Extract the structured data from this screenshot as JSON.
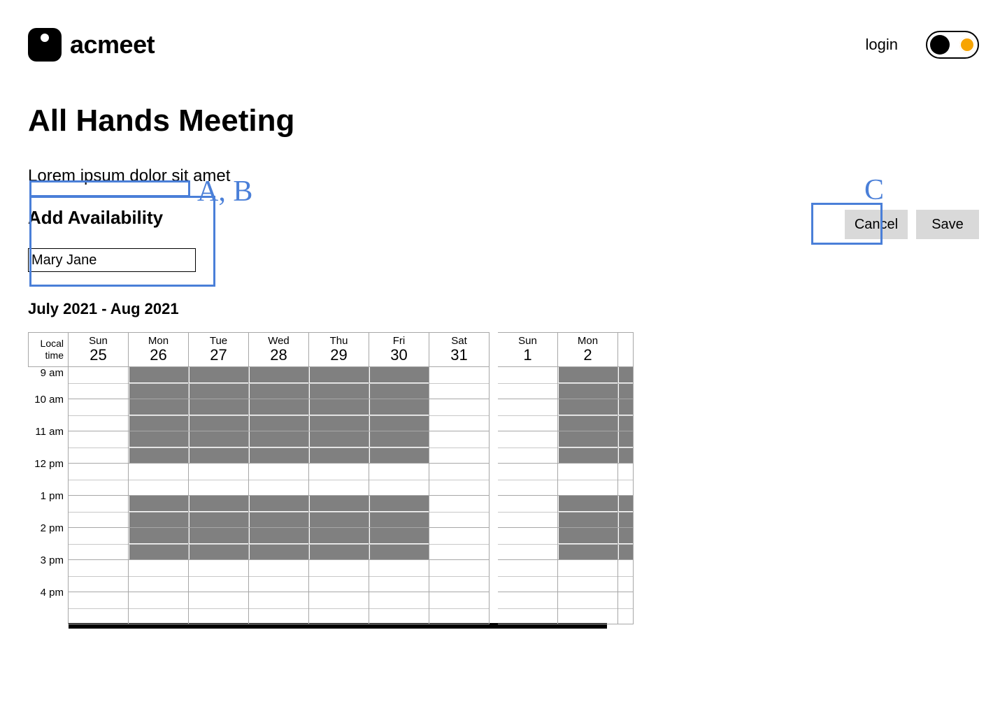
{
  "header": {
    "brand": "acmeet",
    "login": "login"
  },
  "page": {
    "title": "All Hands Meeting",
    "subtitle": "Lorem ipsum dolor sit amet",
    "section_label": "Add Availability",
    "name_value": "Mary Jane",
    "date_range": "July 2021 - Aug  2021"
  },
  "actions": {
    "cancel": "Cancel",
    "save": "Save"
  },
  "schedule": {
    "tz_label_line1": "Local",
    "tz_label_line2": "time",
    "times": [
      "9 am",
      "10 am",
      "11 am",
      "12 pm",
      "1 pm",
      "2 pm",
      "3 pm",
      "4 pm"
    ],
    "days": [
      {
        "dow": "Sun",
        "num": "25"
      },
      {
        "dow": "Mon",
        "num": "26"
      },
      {
        "dow": "Tue",
        "num": "27"
      },
      {
        "dow": "Wed",
        "num": "28"
      },
      {
        "dow": "Thu",
        "num": "29"
      },
      {
        "dow": "Fri",
        "num": "30"
      },
      {
        "dow": "Sat",
        "num": "31"
      },
      {
        "dow": "Sun",
        "num": "1"
      },
      {
        "dow": "Mon",
        "num": "2"
      }
    ],
    "availability": {
      "weekday_morning_rows": [
        0,
        1,
        2,
        3,
        4,
        5
      ],
      "weekday_afternoon_rows": [
        8,
        9,
        10,
        11
      ],
      "weekday_columns": [
        1,
        2,
        3,
        4,
        5,
        8
      ],
      "narrow_column_index": 9
    }
  },
  "annotations": {
    "ab_label": "A, B",
    "c_label": "C"
  }
}
